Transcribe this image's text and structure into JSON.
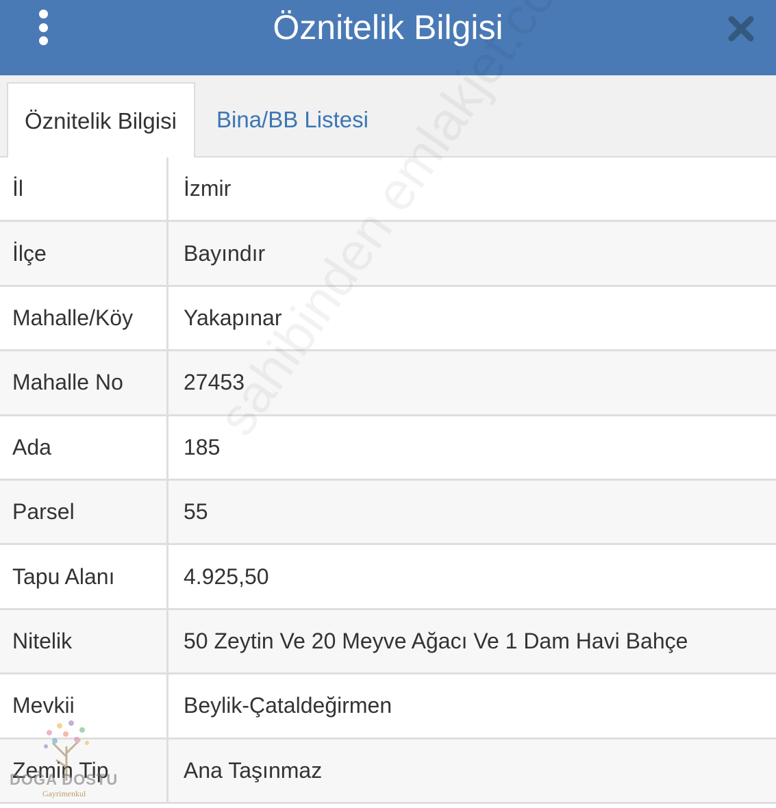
{
  "header": {
    "title": "Öznitelik Bilgisi",
    "menu_icon": "vertical-dots-icon",
    "close_icon": "close-icon",
    "bg_color": "#4a7ab5"
  },
  "tabs": [
    {
      "label": "Öznitelik Bilgisi",
      "active": true
    },
    {
      "label": "Bina/BB Listesi",
      "active": false
    }
  ],
  "attributes": [
    {
      "label": "İl",
      "value": "İzmir"
    },
    {
      "label": "İlçe",
      "value": "Bayındır"
    },
    {
      "label": "Mahalle/Köy",
      "value": "Yakapınar"
    },
    {
      "label": "Mahalle No",
      "value": "27453"
    },
    {
      "label": "Ada",
      "value": "185"
    },
    {
      "label": "Parsel",
      "value": "55"
    },
    {
      "label": "Tapu Alanı",
      "value": "4.925,50"
    },
    {
      "label": "Nitelik",
      "value": "50 Zeytin Ve 20 Meyve Ağacı Ve 1 Dam Havi Bahçe"
    },
    {
      "label": "Mevkii",
      "value": "Beylik-Çataldeğirmen"
    },
    {
      "label": "Zemin Tip",
      "value": "Ana Taşınmaz"
    }
  ],
  "watermark": "sahibinden emlakjet.com",
  "logo": {
    "name": "DOĞA DOSTU",
    "sub": "Gayrimenkul"
  },
  "link_color": "#3a76b5"
}
